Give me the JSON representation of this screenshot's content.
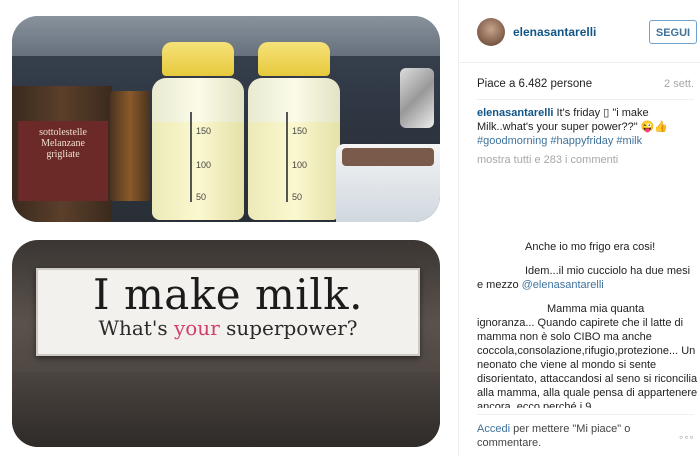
{
  "post": {
    "photo_top": {
      "jar_label": "sottolestelle\nMelanzane\ngrigliate",
      "bottle_marks": [
        "150",
        "100",
        "50"
      ]
    },
    "photo_bottom": {
      "sign_line1": "I make milk.",
      "sign_line2_pre": "What's ",
      "sign_line2_highlight": "your",
      "sign_line2_post": " superpower?"
    }
  },
  "sidebar": {
    "username": "elenasantarelli",
    "follow_label": "SEGUI",
    "likes_text": "Piace a 6.482 persone",
    "age": "2 sett.",
    "caption": {
      "user": "elenasantarelli",
      "text": " It's friday ▯ \"i make Milk..what's your super power??\" 😜👍 ",
      "hashtags": "#goodmorning #happyfriday #milk"
    },
    "show_all": "mostra tutti e 283 i commenti",
    "comments": [
      {
        "text": "Anche io mo frigo era cosi!"
      },
      {
        "text": "Idem...il mio cucciolo ha due mesi e mezzo ",
        "mention": "@elenasantarelli"
      },
      {
        "text": "Mamma mia quanta ignoranza... Quando capirete che il latte di mamma non è solo CIBO ma anche coccola,consolazione,rifugio,protezione... Un neonato che viene al mondo si sente disorientato, attaccandosi al seno si riconcilia alla mamma, alla quale pensa di appartenere ancora, ecco perché i 9"
      }
    ],
    "footer": {
      "login_link": "Accedi",
      "rest": " per mettere \"Mi piace\" o commentare.",
      "more_icon": "◦◦◦"
    }
  }
}
